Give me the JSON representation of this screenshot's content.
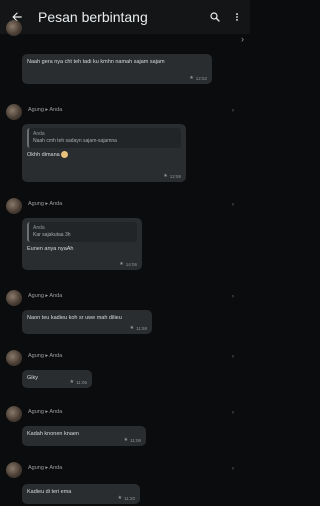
{
  "appbar": {
    "back_icon": "arrow-left-icon",
    "title": "Pesan berbintang",
    "search_icon": "search-icon",
    "menu_icon": "more-vert-icon"
  },
  "messages": [
    {
      "sender": "",
      "date": "",
      "text": "Naah gera nya cht teh tadi ku kmhn namah sajam sajam",
      "time": "12:52",
      "has_quote": false
    },
    {
      "sender": "Agung ▸ Anda",
      "date": "",
      "quote_name": "Anda",
      "quote_text": "Naah cmh teh sadayn sajam-sajamna",
      "text": "Okhh dimana",
      "time": "12:58",
      "has_quote": true
    },
    {
      "sender": "Agung ▸ Anda",
      "date": "",
      "quote_name": "Anda",
      "quote_text": "Kar sajakutaa 3h",
      "text": "Eunen anya nyaAh",
      "time": "14:06",
      "has_quote": true
    },
    {
      "sender": "Agung ▸ Anda",
      "date": "",
      "text": "Naon teu kadieu koh sr uwe mah dilieu",
      "time": "11:58",
      "has_quote": false
    },
    {
      "sender": "Agung ▸ Anda",
      "date": "",
      "text": "Giky",
      "time": "11:06",
      "has_quote": false
    },
    {
      "sender": "Agung ▸ Anda",
      "date": "",
      "text": "Kadah knonen knaen",
      "time": "11:06",
      "has_quote": false
    },
    {
      "sender": "Agung ▸ Anda",
      "date": "",
      "text": "Kadieu di teri ema",
      "time": "11:20",
      "has_quote": false
    }
  ]
}
